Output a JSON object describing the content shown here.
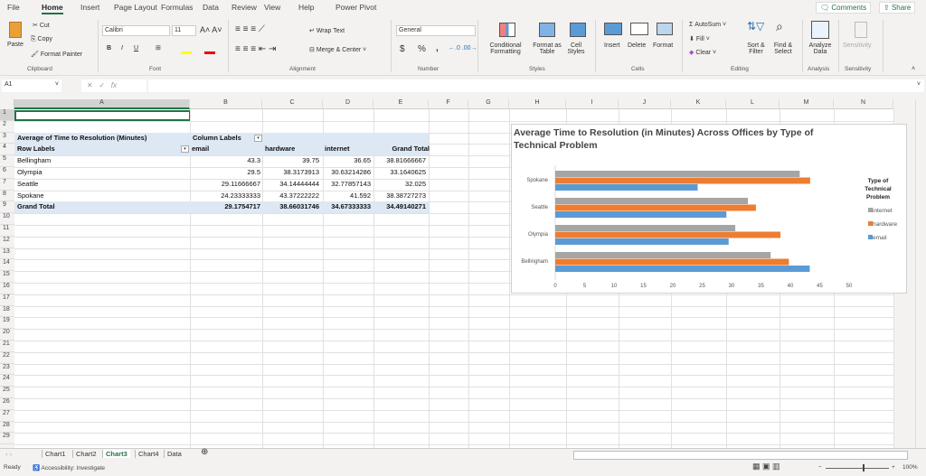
{
  "menu_tabs": [
    "File",
    "Home",
    "Insert",
    "Page Layout",
    "Formulas",
    "Data",
    "Review",
    "View",
    "Help",
    "Power Pivot"
  ],
  "active_tab": "Home",
  "top_buttons": {
    "comments": "Comments",
    "share": "Share"
  },
  "ribbon": {
    "clipboard": {
      "paste": "Paste",
      "cut": "Cut",
      "copy": "Copy",
      "format_painter": "Format Painter",
      "label": "Clipboard"
    },
    "font": {
      "name": "Calibri",
      "size": "11",
      "label": "Font",
      "bold": "B",
      "italic": "I",
      "underline": "U"
    },
    "alignment": {
      "wrap": "Wrap Text",
      "merge": "Merge & Center",
      "label": "Alignment"
    },
    "number": {
      "format": "General",
      "label": "Number",
      "currency": "$",
      "percent": "%",
      "comma": ","
    },
    "styles": {
      "conditional": "Conditional Formatting",
      "format_table": "Format as Table",
      "cell_styles": "Cell Styles",
      "label": "Styles"
    },
    "cells": {
      "insert": "Insert",
      "delete": "Delete",
      "format": "Format",
      "label": "Cells"
    },
    "editing": {
      "autosum": "AutoSum",
      "fill": "Fill",
      "clear": "Clear",
      "sort": "Sort & Filter",
      "find": "Find & Select",
      "label": "Editing"
    },
    "analysis": {
      "analyze": "Analyze Data",
      "label": "Analysis"
    },
    "sensitivity": {
      "btn": "Sensitivity",
      "label": "Sensitivity"
    }
  },
  "formula_bar": {
    "name_box": "A1",
    "fx": "fx",
    "value": ""
  },
  "columns": [
    "A",
    "B",
    "C",
    "D",
    "E",
    "F",
    "G",
    "H",
    "I",
    "J",
    "K",
    "L",
    "M",
    "N"
  ],
  "rows": [
    "1",
    "2",
    "3",
    "4",
    "5",
    "6",
    "7",
    "8",
    "9",
    "10",
    "11",
    "12",
    "13",
    "14",
    "15",
    "16",
    "17",
    "18",
    "19",
    "20",
    "21",
    "22",
    "23",
    "24",
    "25",
    "26",
    "27",
    "28",
    "29"
  ],
  "pivot": {
    "title": "Average of Time to Resolution (Minutes)",
    "column_labels": "Column Labels",
    "row_labels": "Row Labels",
    "headers": [
      "email",
      "hardware",
      "internet",
      "Grand Total"
    ],
    "data": [
      {
        "label": "Bellingham",
        "values": [
          "43.3",
          "39.75",
          "36.65",
          "38.81666667"
        ]
      },
      {
        "label": "Olympia",
        "values": [
          "29.5",
          "38.3173913",
          "30.63214286",
          "33.1640625"
        ]
      },
      {
        "label": "Seattle",
        "values": [
          "29.11666667",
          "34.14444444",
          "32.77857143",
          "32.025"
        ]
      },
      {
        "label": "Spokane",
        "values": [
          "24.23333333",
          "43.37222222",
          "41.592",
          "38.38727273"
        ]
      }
    ],
    "grand_total": {
      "label": "Grand Total",
      "values": [
        "29.1754717",
        "38.66031746",
        "34.67333333",
        "34.49140271"
      ]
    }
  },
  "chart_data": {
    "type": "bar",
    "orientation": "horizontal",
    "title": "Average Time to Resolution (in Minutes) Across Offices by Type of Technical Problem",
    "categories": [
      "Spokane",
      "Seattle",
      "Olympia",
      "Bellingham"
    ],
    "series": [
      {
        "name": "internet",
        "color": "#a5a5a5",
        "values": [
          41.592,
          32.78,
          30.63,
          36.65
        ]
      },
      {
        "name": "hardware",
        "color": "#ed7d31",
        "values": [
          43.37,
          34.14,
          38.32,
          39.75
        ]
      },
      {
        "name": "email",
        "color": "#5b9bd5",
        "values": [
          24.23,
          29.12,
          29.5,
          43.3
        ]
      }
    ],
    "xlim": [
      0,
      50
    ],
    "xticks": [
      "0",
      "5",
      "10",
      "15",
      "20",
      "25",
      "30",
      "35",
      "40",
      "45",
      "50"
    ],
    "legend_title": "Type of Technical Problem",
    "legend": "right"
  },
  "sheet_tabs": [
    "Chart1",
    "Chart2",
    "Chart3",
    "Chart4",
    "Data"
  ],
  "active_sheet": "Chart3",
  "status": {
    "ready": "Ready",
    "accessibility": "Accessibility: Investigate",
    "zoom": "100%"
  }
}
